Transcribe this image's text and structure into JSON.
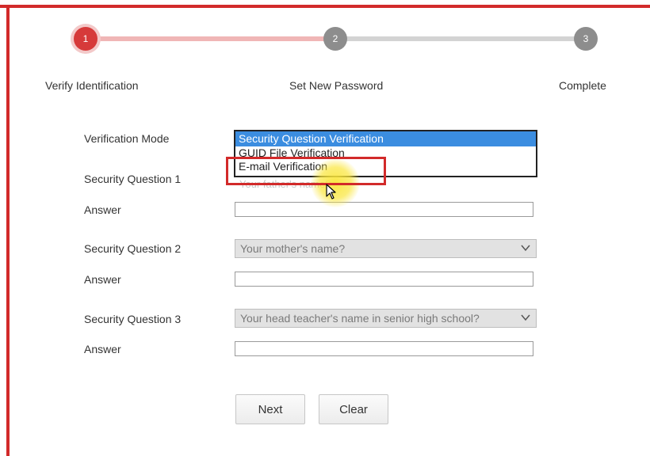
{
  "stepper": {
    "steps": [
      {
        "number": "1",
        "label": "Verify Identification",
        "state": "active"
      },
      {
        "number": "2",
        "label": "Set New Password",
        "state": "pending"
      },
      {
        "number": "3",
        "label": "Complete",
        "state": "pending"
      }
    ],
    "accent_color": "#d63a3a",
    "pending_color": "#8d8d8d"
  },
  "form": {
    "verification_mode": {
      "label": "Verification Mode",
      "options": [
        "Security Question Verification",
        "GUID File Verification",
        "E-mail Verification"
      ],
      "selected": "Security Question Verification",
      "highlighted_option": "E-mail Verification"
    },
    "questions": [
      {
        "label": "Security Question 1",
        "value": "Your father's name?",
        "answer_label": "Answer",
        "answer_value": ""
      },
      {
        "label": "Security Question 2",
        "value": "Your mother's name?",
        "answer_label": "Answer",
        "answer_value": ""
      },
      {
        "label": "Security Question 3",
        "value": "Your head teacher's name in senior high school?",
        "answer_label": "Answer",
        "answer_value": ""
      }
    ]
  },
  "buttons": {
    "next": "Next",
    "clear": "Clear"
  },
  "icons": {
    "dropdown": "chevron-down-icon",
    "cursor": "mouse-pointer-icon"
  }
}
